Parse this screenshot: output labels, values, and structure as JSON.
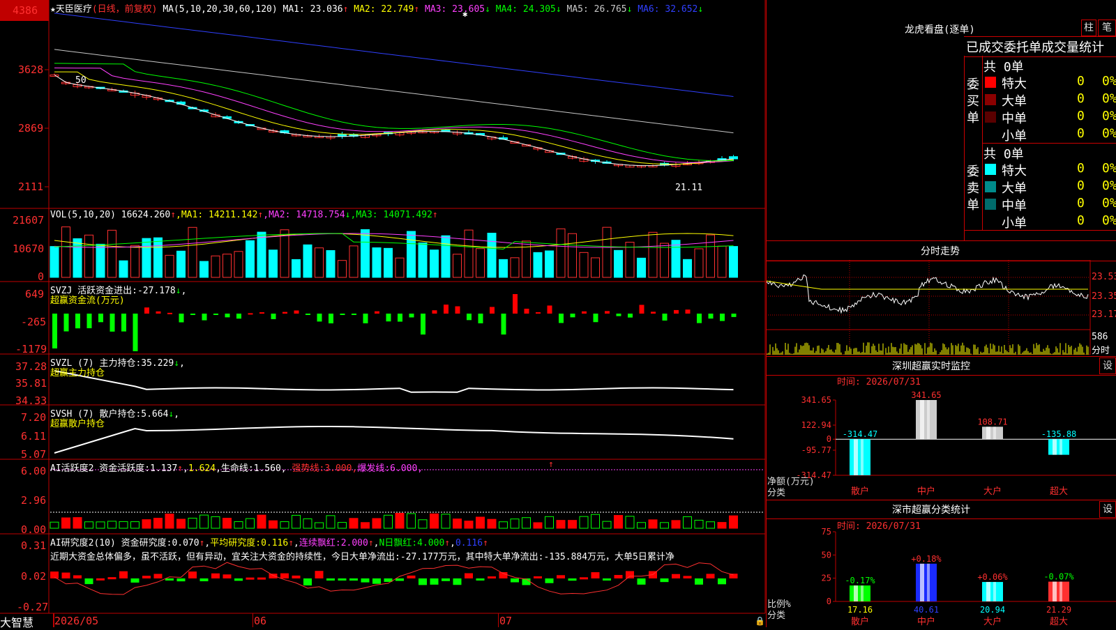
{
  "stock": {
    "name": "天臣医疗",
    "period": "(日线，前复权)",
    "ma_label": "MA(5,10,20,30,60,120)",
    "ma_values": [
      {
        "label": "MA1:",
        "value": "23.036",
        "arrow": "↑",
        "color": "#ffffff"
      },
      {
        "label": "MA2:",
        "value": "22.749",
        "arrow": "↑",
        "color": "#ffff00"
      },
      {
        "label": "MA3:",
        "value": "23.605",
        "arrow": "↓",
        "color": "#ff40ff"
      },
      {
        "label": "MA4:",
        "value": "24.305",
        "arrow": "↓",
        "color": "#00ff00"
      },
      {
        "label": "MA5:",
        "value": "26.765",
        "arrow": "↓",
        "color": "#c8c8c8"
      },
      {
        "label": "MA6:",
        "value": "32.652",
        "arrow": "↓",
        "color": "#3040ff"
      }
    ],
    "price_ticks": [
      "4386",
      "3628",
      "2869",
      "2111"
    ],
    "high_label": "50",
    "low_label": "21.11"
  },
  "vol": {
    "header": "VOL(5,10,20)",
    "value": "16624.260",
    "ma": [
      {
        "label": "MA1:",
        "value": "14211.142",
        "arrow": "↑",
        "color": "#ffff00"
      },
      {
        "label": "MA2:",
        "value": "14718.754",
        "arrow": "↓",
        "color": "#ff40ff"
      },
      {
        "label": "MA3:",
        "value": "14071.492",
        "arrow": "↑",
        "color": "#00ff00"
      }
    ],
    "ticks": [
      "21607",
      "10670",
      "0"
    ]
  },
  "svzj": {
    "header": "SVZJ  活跃资金进出:",
    "value": "-27.178",
    "arrow": "↓",
    "sub": "超赢资金流(万元)",
    "ticks": [
      "649",
      "-265",
      "-1179"
    ]
  },
  "svzl": {
    "header": "SVZL (7) 主力持仓:",
    "value": "35.229",
    "arrow": "↓",
    "sub": "超赢主力持仓",
    "ticks": [
      "37.28",
      "35.81",
      "34.33"
    ]
  },
  "svsh": {
    "header": "SVSH (7) 散户持仓:",
    "value": "5.664",
    "arrow": "↓",
    "sub": "超赢散户持仓",
    "ticks": [
      "7.20",
      "6.11",
      "5.07"
    ]
  },
  "ai1": {
    "header": "AI活跃度2 资金活跃度:",
    "v1": "1.137",
    "v2": "1.624",
    "life_label": "生命线:",
    "life": "1.560",
    "strong_label": "强势线:",
    "strong": "3.000",
    "burst_label": "爆发线:",
    "burst": "6.000",
    "ticks": [
      "6.00",
      "2.96",
      "0.00"
    ]
  },
  "ai2": {
    "header": "AI研究度2(10) 资金研究度:",
    "v1": "0.070",
    "avg_label": "平均研究度:",
    "avg": "0.116",
    "red_label": "连续飘红:",
    "red": "2.000",
    "nred_label": "N日飘红:",
    "nred": "4.000",
    "v5": "0.116",
    "text": "近期大资金总体偏多，虽不活跃，但有异动，宜关注大资金的持续性，今日大单净流出:-27.177万元，其中特大单净流出:-135.884万元，大单5日累计净",
    "ticks": [
      "0.31",
      "0.02",
      "-0.27"
    ]
  },
  "xaxis": {
    "labels": [
      "2026/05",
      "06",
      "07"
    ]
  },
  "footer_logo": "大智慧",
  "lhb": {
    "title": "龙虎看盘(逐单)",
    "btn1": "柱",
    "btn2": "笔",
    "tabs": "已成交委托单成交量统计",
    "buy": {
      "side": "委买单",
      "total": "共 0单",
      "rows": [
        {
          "name": "特大",
          "count": "0",
          "pct": "0%",
          "color": "#ff0000"
        },
        {
          "name": "大单",
          "count": "0",
          "pct": "0%",
          "color": "#8b0000"
        },
        {
          "name": "中单",
          "count": "0",
          "pct": "0%",
          "color": "#5a0000"
        },
        {
          "name": "小单",
          "count": "0",
          "pct": "0%",
          "color": "#000000"
        }
      ]
    },
    "sell": {
      "side": "委卖单",
      "total": "共 0单",
      "rows": [
        {
          "name": "特大",
          "count": "0",
          "pct": "0%",
          "color": "#00ffff"
        },
        {
          "name": "大单",
          "count": "0",
          "pct": "0%",
          "color": "#008b8b"
        },
        {
          "name": "中单",
          "count": "0",
          "pct": "0%",
          "color": "#006b6b"
        },
        {
          "name": "小单",
          "count": "0",
          "pct": "0%",
          "color": "#000000"
        }
      ]
    }
  },
  "intraday": {
    "title": "分时走势",
    "ticks": [
      "23.53",
      "23.35",
      "23.17"
    ],
    "vol": "586",
    "vol_unit": "分时"
  },
  "monitor": {
    "title": "深圳超赢实时监控",
    "btn": "设",
    "time": "时间: 2026/07/31",
    "ticks": [
      "341.65",
      "122.94",
      "0",
      "-95.77",
      "-314.47"
    ],
    "y_title": "净额(万元)",
    "x_title": "分类",
    "values": [
      "-314.47",
      "341.65",
      "108.71",
      "-135.88"
    ],
    "categories": [
      "散户",
      "中户",
      "大户",
      "超大"
    ]
  },
  "classify": {
    "title": "深市超赢分类统计",
    "btn": "设",
    "time": "时间: 2026/07/31",
    "ticks": [
      "75",
      "50",
      "25",
      "0"
    ],
    "y_title": "比例%",
    "x_title": "分类",
    "changes": [
      "-0.17%",
      "+0.18%",
      "+0.06%",
      "-0.07%"
    ],
    "values": [
      "17.16",
      "40.61",
      "20.94",
      "21.29"
    ],
    "categories": [
      "散户",
      "中户",
      "大户",
      "超大"
    ]
  },
  "chart_data": [
    {
      "type": "bar",
      "title": "深圳超赢实时监控",
      "ylabel": "净额(万元)",
      "xlabel": "分类",
      "categories": [
        "散户",
        "中户",
        "大户",
        "超大"
      ],
      "values": [
        -314.47,
        341.65,
        108.71,
        -135.88
      ],
      "ylim": [
        -314.47,
        341.65
      ]
    },
    {
      "type": "bar",
      "title": "深市超赢分类统计",
      "ylabel": "比例%",
      "xlabel": "分类",
      "categories": [
        "散户",
        "中户",
        "大户",
        "超大"
      ],
      "values": [
        17.16,
        40.61,
        20.94,
        21.29
      ],
      "ylim": [
        0,
        75
      ]
    }
  ]
}
